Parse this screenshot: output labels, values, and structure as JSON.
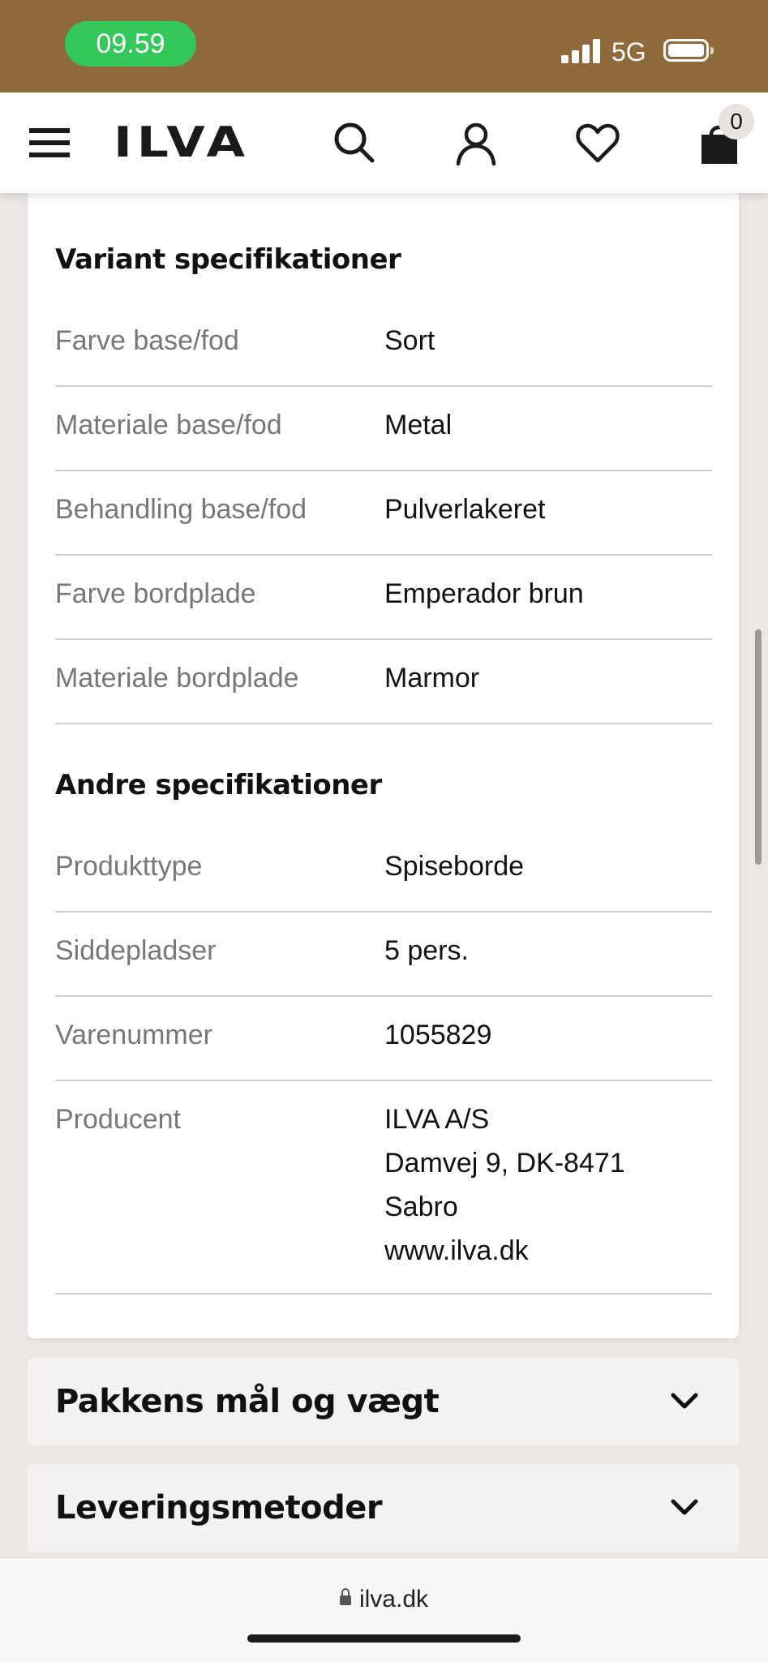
{
  "status_bar": {
    "time": "09.59",
    "network": "5G"
  },
  "header": {
    "logo": "ILVA",
    "cart_count": "0"
  },
  "variant_specs": {
    "title": "Variant specifikationer",
    "rows": [
      {
        "label": "Farve base/fod",
        "value": "Sort"
      },
      {
        "label": "Materiale base/fod",
        "value": "Metal"
      },
      {
        "label": "Behandling base/fod",
        "value": "Pulverlakeret"
      },
      {
        "label": "Farve bordplade",
        "value": "Emperador brun"
      },
      {
        "label": "Materiale bordplade",
        "value": "Marmor"
      }
    ]
  },
  "other_specs": {
    "title": "Andre specifikationer",
    "rows": [
      {
        "label": "Produkttype",
        "value": "Spiseborde"
      },
      {
        "label": "Siddepladser",
        "value": "5 pers."
      },
      {
        "label": "Varenummer",
        "value": "1055829"
      }
    ],
    "producer": {
      "label": "Producent",
      "lines": [
        "ILVA A/S",
        "Damvej 9, DK-8471",
        "Sabro",
        "www.ilva.dk"
      ]
    }
  },
  "accordions": [
    {
      "title": "Pakkens mål og vægt"
    },
    {
      "title": "Leveringsmetoder"
    }
  ],
  "browser": {
    "url": "ilva.dk"
  }
}
